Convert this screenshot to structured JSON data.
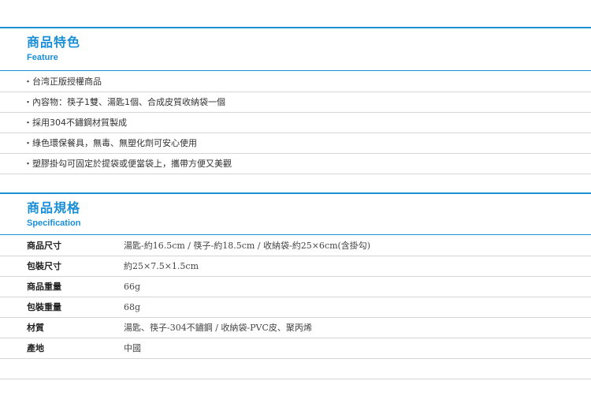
{
  "feature": {
    "title_zh": "商品特色",
    "title_en": "Feature",
    "items": [
      "台湾正版授權商品",
      "內容物：筷子1雙、湯匙1個、合成皮質收納袋一個",
      "採用304不鏽鋼材質製成",
      "綠色環保餐具，無毒、無塑化劑可安心使用",
      "塑膠掛勾可固定於提袋或便當袋上，攜帶方便又美觀"
    ],
    "bullet": "・"
  },
  "spec": {
    "title_zh": "商品規格",
    "title_en": "Specification",
    "rows": [
      {
        "label": "商品尺寸",
        "value": "湯匙-約16.5cm / 筷子-約18.5cm / 收納袋-約25×6cm(含掛勾)"
      },
      {
        "label": "包裝尺寸",
        "value": "約25×7.5×1.5cm"
      },
      {
        "label": "商品重量",
        "value": "66g"
      },
      {
        "label": "包裝重量",
        "value": "68g"
      },
      {
        "label": "材質",
        "value": "湯匙、筷子-304不鏽鋼 / 收納袋-PVC皮、聚丙烯"
      },
      {
        "label": "產地",
        "value": "中國"
      }
    ]
  },
  "colors": {
    "accent": "#1a8fd8",
    "divider": "#d4d4d4"
  }
}
